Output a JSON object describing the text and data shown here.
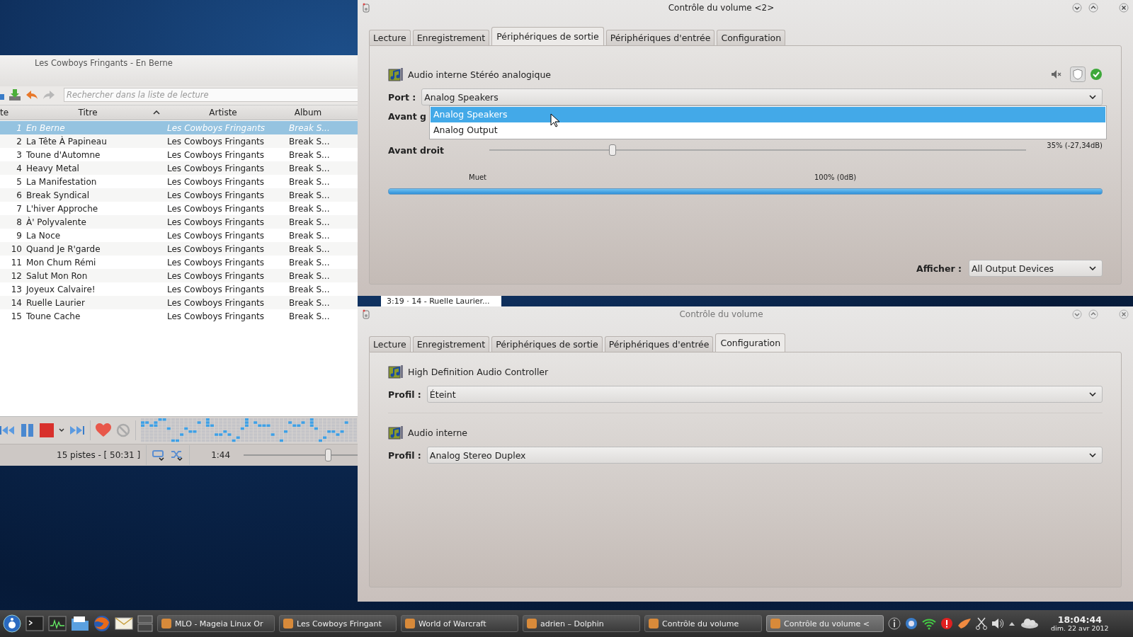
{
  "player": {
    "title": "Les Cowboys Fringants - En Berne",
    "search": {
      "placeholder": "Rechercher dans la liste de lecture"
    },
    "columns": [
      "te",
      "Titre",
      "Artiste",
      "Album"
    ],
    "rows": [
      {
        "number": "1",
        "title": "En Berne",
        "artist": "Les Cowboys Fringants",
        "album": "Break S...",
        "selected": true
      },
      {
        "number": "2",
        "title": "La Tête À Papineau",
        "artist": "Les Cowboys Fringants",
        "album": "Break S...",
        "selected": false
      },
      {
        "number": "3",
        "title": "Toune d'Automne",
        "artist": "Les Cowboys Fringants",
        "album": "Break S...",
        "selected": false
      },
      {
        "number": "4",
        "title": "Heavy Metal",
        "artist": "Les Cowboys Fringants",
        "album": "Break S...",
        "selected": false
      },
      {
        "number": "5",
        "title": "La Manifestation",
        "artist": "Les Cowboys Fringants",
        "album": "Break S...",
        "selected": false
      },
      {
        "number": "6",
        "title": "Break Syndical",
        "artist": "Les Cowboys Fringants",
        "album": "Break S...",
        "selected": false
      },
      {
        "number": "7",
        "title": "L'hiver Approche",
        "artist": "Les Cowboys Fringants",
        "album": "Break S...",
        "selected": false
      },
      {
        "number": "8",
        "title": "À' Polyvalente",
        "artist": "Les Cowboys Fringants",
        "album": "Break S...",
        "selected": false
      },
      {
        "number": "9",
        "title": "La Noce",
        "artist": "Les Cowboys Fringants",
        "album": "Break S...",
        "selected": false
      },
      {
        "number": "10",
        "title": "Quand Je R'garde",
        "artist": "Les Cowboys Fringants",
        "album": "Break S...",
        "selected": false
      },
      {
        "number": "11",
        "title": "Mon Chum Rémi",
        "artist": "Les Cowboys Fringants",
        "album": "Break S...",
        "selected": false
      },
      {
        "number": "12",
        "title": "Salut Mon Ron",
        "artist": "Les Cowboys Fringants",
        "album": "Break S...",
        "selected": false
      },
      {
        "number": "13",
        "title": "Joyeux Calvaire!",
        "artist": "Les Cowboys Fringants",
        "album": "Break S...",
        "selected": false
      },
      {
        "number": "14",
        "title": "Ruelle Laurier",
        "artist": "Les Cowboys Fringants",
        "album": "Break S...",
        "selected": false
      },
      {
        "number": "15",
        "title": "Toune Cache",
        "artist": "Les Cowboys Fringants",
        "album": "Break S...",
        "selected": false
      }
    ],
    "track_count": "15 pistes - [ 50:31 ]",
    "time": "1:44",
    "position": {
      "level": 0.74
    },
    "behind_text": "3:19 · 14 - Ruelle Laurier..."
  },
  "volume_window": {
    "title": "Contrôle du volume <2>",
    "tabs": [
      {
        "label": "Lecture",
        "selected": false
      },
      {
        "label": "Enregistrement",
        "selected": false
      },
      {
        "label": "Périphériques de sortie",
        "selected": true
      },
      {
        "label": "Périphériques d'entrée",
        "selected": false
      },
      {
        "label": "Configuration",
        "selected": false
      }
    ],
    "device": "Audio interne Stéréo analogique",
    "port": {
      "label": "Port :",
      "value": "Analog Speakers",
      "options": [
        {
          "label": "Analog Speakers",
          "selected": true
        },
        {
          "label": "Analog Output",
          "selected": false
        }
      ]
    },
    "channels": [
      {
        "name": "Avant g"
      },
      {
        "name": "Avant droit",
        "level": 0.23,
        "reading": "35% (-27,34dB)"
      }
    ],
    "ticks": [
      "Muet",
      "100% (0dB)"
    ],
    "meter": {
      "level": 1
    },
    "show": {
      "label": "Afficher :",
      "value": "All Output Devices"
    }
  },
  "config_window": {
    "title": "Contrôle du volume",
    "tabs": [
      {
        "label": "Lecture",
        "selected": false
      },
      {
        "label": "Enregistrement",
        "selected": false
      },
      {
        "label": "Périphériques de sortie",
        "selected": false
      },
      {
        "label": "Périphériques d'entrée",
        "selected": false
      },
      {
        "label": "Configuration",
        "selected": true
      }
    ],
    "cards": [
      {
        "name": "High Definition Audio Controller",
        "label": "Profil :",
        "value": "Éteint"
      },
      {
        "name": "Audio interne",
        "label": "Profil :",
        "value": "Analog Stereo Duplex"
      }
    ]
  },
  "taskbar": {
    "tasks": [
      {
        "label": "MLO - Mageia Linux Or",
        "selected": false
      },
      {
        "label": "Les Cowboys Fringant",
        "selected": false
      },
      {
        "label": "World of Warcraft",
        "selected": false
      },
      {
        "label": "adrien – Dolphin",
        "selected": false
      },
      {
        "label": "Contrôle du volume",
        "selected": false
      },
      {
        "label": "Contrôle du volume <",
        "selected": true
      }
    ],
    "clock": "18:04:44",
    "date": "dim. 22 avr 2012"
  }
}
